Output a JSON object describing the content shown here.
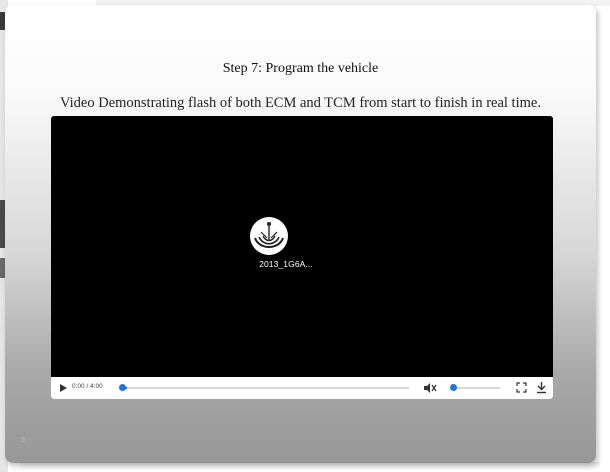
{
  "slide": {
    "title": "Step 7: Program the vehicle",
    "subtitle": "Video Demonstrating flash of both ECM and TCM from start to finish in real time.",
    "page_number": "9"
  },
  "video": {
    "filename": "2013_1G6A...",
    "time_display": "0:00 / 4:00",
    "progress_fraction": 0.0,
    "volume_fraction": 0.0,
    "muted": true,
    "icons": {
      "play": "play-icon",
      "mute": "volume-muted-icon",
      "fullscreen": "fullscreen-icon",
      "download": "download-icon",
      "thumbnail": "logo-thumbnail-icon"
    },
    "accent_color": "#1a73e8"
  }
}
